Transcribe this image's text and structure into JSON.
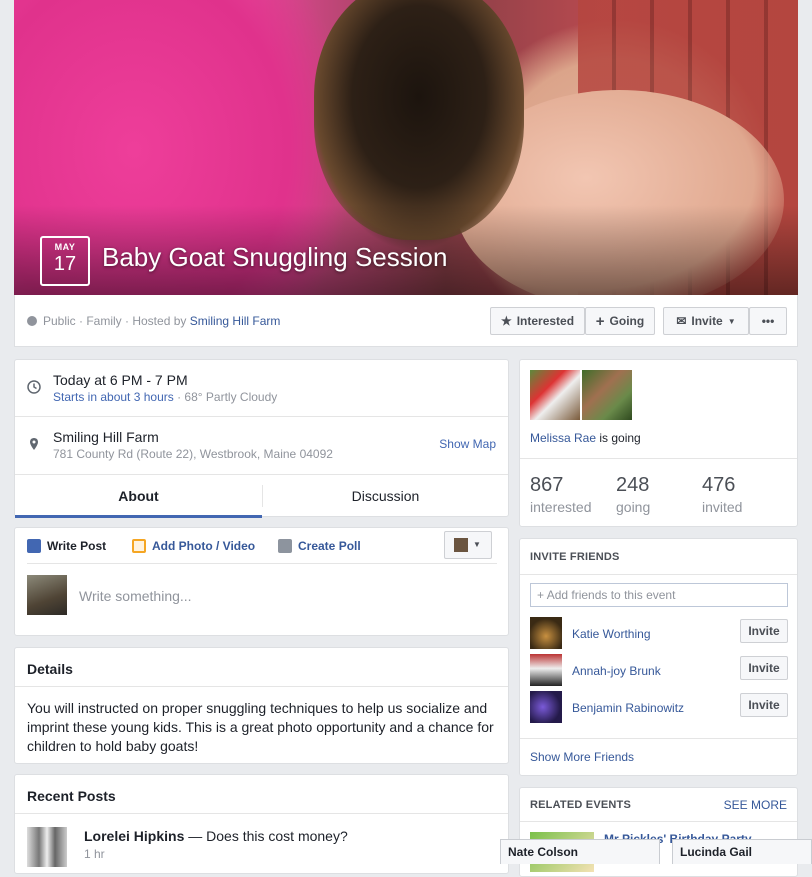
{
  "event": {
    "month": "MAY",
    "day": "17",
    "title": "Baby Goat Snuggling Session",
    "meta_prefix": "Public · Family · Hosted by",
    "host": "Smiling Hill Farm"
  },
  "actions": {
    "interested": "Interested",
    "going": "Going",
    "invite": "Invite",
    "more": "•••"
  },
  "when": {
    "time": "Today at 6 PM - 7 PM",
    "starts": "Starts in about 3 hours",
    "weather": " · 68° Partly Cloudy"
  },
  "where": {
    "name": "Smiling Hill Farm",
    "address": "781 County Rd (Route 22), Westbrook, Maine 04092",
    "show_map": "Show Map"
  },
  "tabs": [
    "About",
    "Discussion"
  ],
  "composer": {
    "write_post": "Write Post",
    "add_photo": "Add Photo / Video",
    "create_poll": "Create Poll",
    "placeholder": "Write something..."
  },
  "details": {
    "heading": "Details",
    "text": "You will instructed on proper snuggling techniques to help us socialize and imprint these young kids. This is a great photo opportunity and a chance for children to hold baby goats!"
  },
  "recent": {
    "heading": "Recent Posts",
    "author": "Lorelei Hipkins",
    "snippet": " — Does this cost money?",
    "time": "1 hr"
  },
  "attendance": {
    "going_person": "Melissa Rae",
    "going_suffix": " is going",
    "interested_count": "867",
    "interested_label": "interested",
    "going_count": "248",
    "going_label": "going",
    "invited_count": "476",
    "invited_label": "invited"
  },
  "invite_friends": {
    "heading": "INVITE FRIENDS",
    "placeholder": "Add friends to this event",
    "friends": [
      {
        "name": "Katie Worthing",
        "button": "Invite"
      },
      {
        "name": "Annah-joy Brunk",
        "button": "Invite"
      },
      {
        "name": "Benjamin Rabinowitz",
        "button": "Invite"
      }
    ],
    "show_more": "Show More Friends"
  },
  "related": {
    "heading": "RELATED EVENTS",
    "see_more": "SEE MORE",
    "first_event": "Mr Pickles' Birthday Party"
  },
  "chat": {
    "tab1": "Nate Colson",
    "tab2": "Lucinda Gail"
  },
  "colors": {
    "link": "#365899",
    "accent": "#4267b2",
    "muted": "#90949c"
  }
}
